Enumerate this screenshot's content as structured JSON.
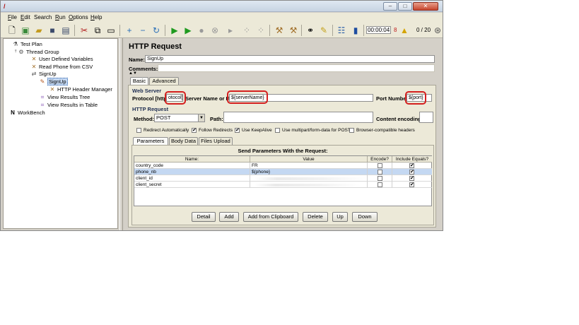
{
  "menu": {
    "items": [
      {
        "mnemonic": "F",
        "rest": "ile"
      },
      {
        "mnemonic": "E",
        "rest": "dit"
      },
      {
        "mnemonic": "",
        "rest": "Search"
      },
      {
        "mnemonic": "R",
        "rest": "un"
      },
      {
        "mnemonic": "O",
        "rest": "ptions"
      },
      {
        "mnemonic": "H",
        "rest": "elp"
      }
    ]
  },
  "toolbar": {
    "timer": "00:00:04",
    "warning_count": "8",
    "threads": "0 / 20"
  },
  "tree": {
    "items": [
      {
        "label": "Test Plan",
        "icon": "test-plan-icon"
      },
      {
        "label": "Thread Group",
        "icon": "thread-group-icon"
      },
      {
        "label": "User Defined Variables",
        "icon": "config-icon"
      },
      {
        "label": "Read Phone from CSV",
        "icon": "config-icon"
      },
      {
        "label": "SignUp",
        "icon": "controller-icon"
      },
      {
        "label": "SignUp",
        "icon": "sampler-icon"
      },
      {
        "label": "HTTP Header Manager",
        "icon": "config-icon"
      },
      {
        "label": "View Results Tree",
        "icon": "listener-icon"
      },
      {
        "label": "View Results in Table",
        "icon": "listener-icon"
      },
      {
        "label": "WorkBench",
        "icon": "workbench-icon"
      }
    ]
  },
  "editor": {
    "title": "HTTP Request",
    "name_label": "Name:",
    "name_value": "SignUp",
    "comments_label": "Comments:",
    "tabs": [
      "Basic",
      "Advanced"
    ],
    "web_server": {
      "title": "Web Server",
      "protocol_label": "Protocol [http]:",
      "protocol_value": "otocol}",
      "server_label": "Server Name or IP:",
      "server_value": "${serverName}",
      "port_label": "Port Number:",
      "port_value": "${port}"
    },
    "http_request": {
      "title": "HTTP Request",
      "method_label": "Method:",
      "method_value": "POST",
      "path_label": "Path:",
      "path_value": "",
      "encoding_label": "Content encoding:",
      "encoding_value": ""
    },
    "options": [
      {
        "label": "Redirect Automatically",
        "checked": false
      },
      {
        "label": "Follow Redirects",
        "checked": true
      },
      {
        "label": "Use KeepAlive",
        "checked": true
      },
      {
        "label": "Use multipart/form-data for POST",
        "checked": false
      },
      {
        "label": "Browser-compatible headers",
        "checked": false
      }
    ],
    "sub_tabs": [
      "Parameters",
      "Body Data",
      "Files Upload"
    ],
    "params": {
      "caption": "Send Parameters With the Request:",
      "headers": [
        "Name:",
        "Value",
        "Encode?",
        "Include Equals?"
      ],
      "rows": [
        {
          "name": "country_code",
          "value": "FR",
          "encode": false,
          "include": true
        },
        {
          "name": "phone_nb",
          "value": "${phone}",
          "encode": false,
          "include": true
        },
        {
          "name": "client_id",
          "value": "",
          "encode": false,
          "include": true
        },
        {
          "name": "client_secret",
          "value": "",
          "encode": false,
          "include": true
        }
      ]
    },
    "buttons": [
      "Detail",
      "Add",
      "Add from Clipboard",
      "Delete",
      "Up",
      "Down"
    ]
  },
  "colors": {
    "highlight": "#d41f1f",
    "selection": "#c4d8f2",
    "panel": "#ece9d8"
  }
}
